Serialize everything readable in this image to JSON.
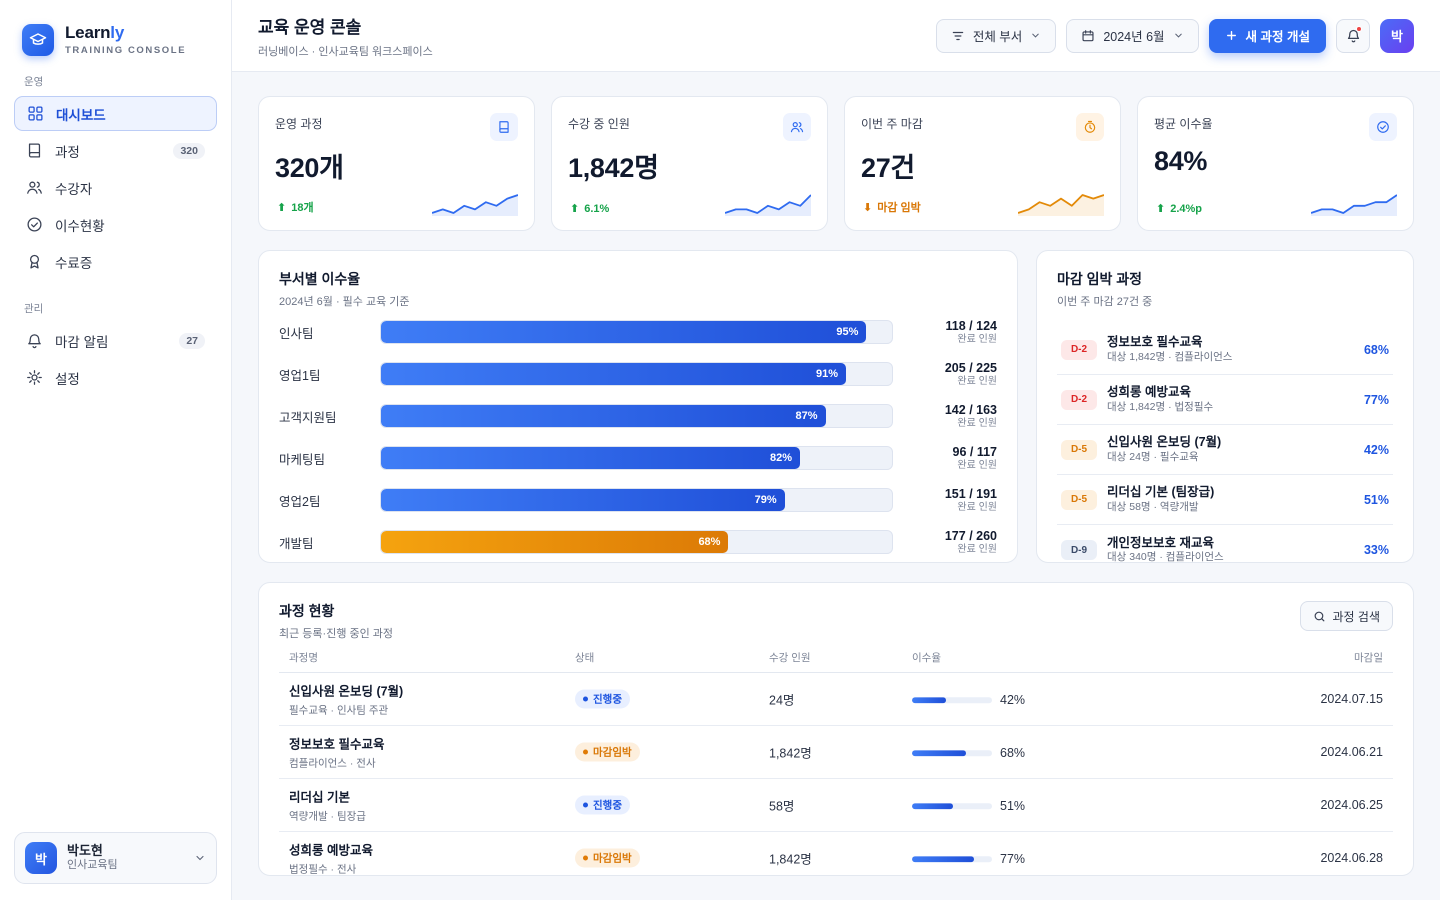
{
  "brand": {
    "name_main": "Learn",
    "name_accent": "ly",
    "subtitle": "TRAINING CONSOLE"
  },
  "sidebar": {
    "section_ops": "운영",
    "section_admin": "관리",
    "items": [
      {
        "label": "대시보드",
        "icon": "grid-icon"
      },
      {
        "label": "과정",
        "icon": "book-icon",
        "badge": "320"
      },
      {
        "label": "수강자",
        "icon": "users-icon"
      },
      {
        "label": "이수현황",
        "icon": "check-circle-icon"
      },
      {
        "label": "수료증",
        "icon": "award-icon"
      },
      {
        "label": "마감 알림",
        "icon": "bell-icon",
        "badge": "27"
      },
      {
        "label": "설정",
        "icon": "gear-icon"
      }
    ],
    "user": {
      "initial": "박",
      "name": "박도현",
      "team": "인사교육팀"
    }
  },
  "header": {
    "title": "교육 운영 콘솔",
    "subtitle": "러닝베이스 · 인사교육팀 워크스페이스",
    "filter_dept": "전체 부서",
    "filter_month": "2024년 6월",
    "new_course": "새 과정 개설",
    "avatar_initial": "박"
  },
  "kpis": [
    {
      "label": "운영 과정",
      "value": "320개",
      "delta": "18개",
      "trend": "up",
      "spark": [
        4,
        5,
        4,
        6,
        5,
        7,
        6,
        8,
        9
      ]
    },
    {
      "label": "수강 중 인원",
      "value": "1,842명",
      "delta": "6.1%",
      "trend": "up",
      "spark": [
        4,
        5,
        5,
        4,
        6,
        5,
        7,
        6,
        9
      ]
    },
    {
      "label": "이번 주 마감",
      "value": "27건",
      "delta": "마감 임박",
      "trend": "warn",
      "spark": [
        3,
        4,
        6,
        5,
        7,
        5,
        8,
        7,
        8
      ]
    },
    {
      "label": "평균 이수율",
      "value": "84%",
      "delta": "2.4%p",
      "trend": "up",
      "spark": [
        4,
        5,
        5,
        4,
        6,
        6,
        7,
        7,
        9
      ]
    }
  ],
  "dept_completion": {
    "title": "부서별 이수율",
    "subtitle": "2024년 6월 · 필수 교육 기준",
    "unit_label": "완료 인원",
    "rows": [
      {
        "name": "인사팀",
        "pct": 95,
        "pct_label": "95%",
        "count": "118 / 124"
      },
      {
        "name": "영업1팀",
        "pct": 91,
        "pct_label": "91%",
        "count": "205 / 225"
      },
      {
        "name": "고객지원팀",
        "pct": 87,
        "pct_label": "87%",
        "count": "142 / 163"
      },
      {
        "name": "마케팅팀",
        "pct": 82,
        "pct_label": "82%",
        "count": "96 / 117"
      },
      {
        "name": "영업2팀",
        "pct": 79,
        "pct_label": "79%",
        "count": "151 / 191"
      },
      {
        "name": "개발팀",
        "pct": 68,
        "pct_label": "68%",
        "count": "177 / 260",
        "warn": true
      }
    ]
  },
  "deadlines": {
    "title": "마감 임박 과정",
    "subtitle": "이번 주 마감 27건 중",
    "items": [
      {
        "tag": "D-2",
        "level": "red",
        "name": "정보보호 필수교육",
        "meta": "대상 1,842명 · 컴플라이언스",
        "pct": "68%"
      },
      {
        "tag": "D-2",
        "level": "red",
        "name": "성희롱 예방교육",
        "meta": "대상 1,842명 · 법정필수",
        "pct": "77%"
      },
      {
        "tag": "D-5",
        "level": "org",
        "name": "신입사원 온보딩 (7월)",
        "meta": "대상 24명 · 필수교육",
        "pct": "42%"
      },
      {
        "tag": "D-5",
        "level": "org",
        "name": "리더십 기본 (팀장급)",
        "meta": "대상 58명 · 역량개발",
        "pct": "51%"
      },
      {
        "tag": "D-9",
        "level": "gry",
        "name": "개인정보보호 재교육",
        "meta": "대상 340명 · 컴플라이언스",
        "pct": "33%"
      }
    ]
  },
  "courses": {
    "title": "과정 현황",
    "subtitle": "최근 등록·진행 중인 과정",
    "search_label": "과정 검색",
    "columns": {
      "name": "과정명",
      "status": "상태",
      "learners": "수강 인원",
      "rate": "이수율",
      "due": "마감일"
    },
    "rows": [
      {
        "name": "신입사원 온보딩 (7월)",
        "meta": "필수교육 · 인사팀 주관",
        "status": "진행중",
        "status_type": "blue",
        "learners": "24명",
        "rate": 42,
        "rate_label": "42%",
        "due": "2024.07.15"
      },
      {
        "name": "정보보호 필수교육",
        "meta": "컴플라이언스 · 전사",
        "status": "마감임박",
        "status_type": "orange",
        "learners": "1,842명",
        "rate": 68,
        "rate_label": "68%",
        "due": "2024.06.21"
      },
      {
        "name": "리더십 기본",
        "meta": "역량개발 · 팀장급",
        "status": "진행중",
        "status_type": "blue",
        "learners": "58명",
        "rate": 51,
        "rate_label": "51%",
        "due": "2024.06.25"
      },
      {
        "name": "성희롱 예방교육",
        "meta": "법정필수 · 전사",
        "status": "마감임박",
        "status_type": "orange",
        "learners": "1,842명",
        "rate": 77,
        "rate_label": "77%",
        "due": "2024.06.28"
      }
    ]
  },
  "colors": {
    "accent": "#2f6bf0",
    "warn": "#e38a08",
    "success": "#16a34a",
    "danger": "#dc2626"
  }
}
